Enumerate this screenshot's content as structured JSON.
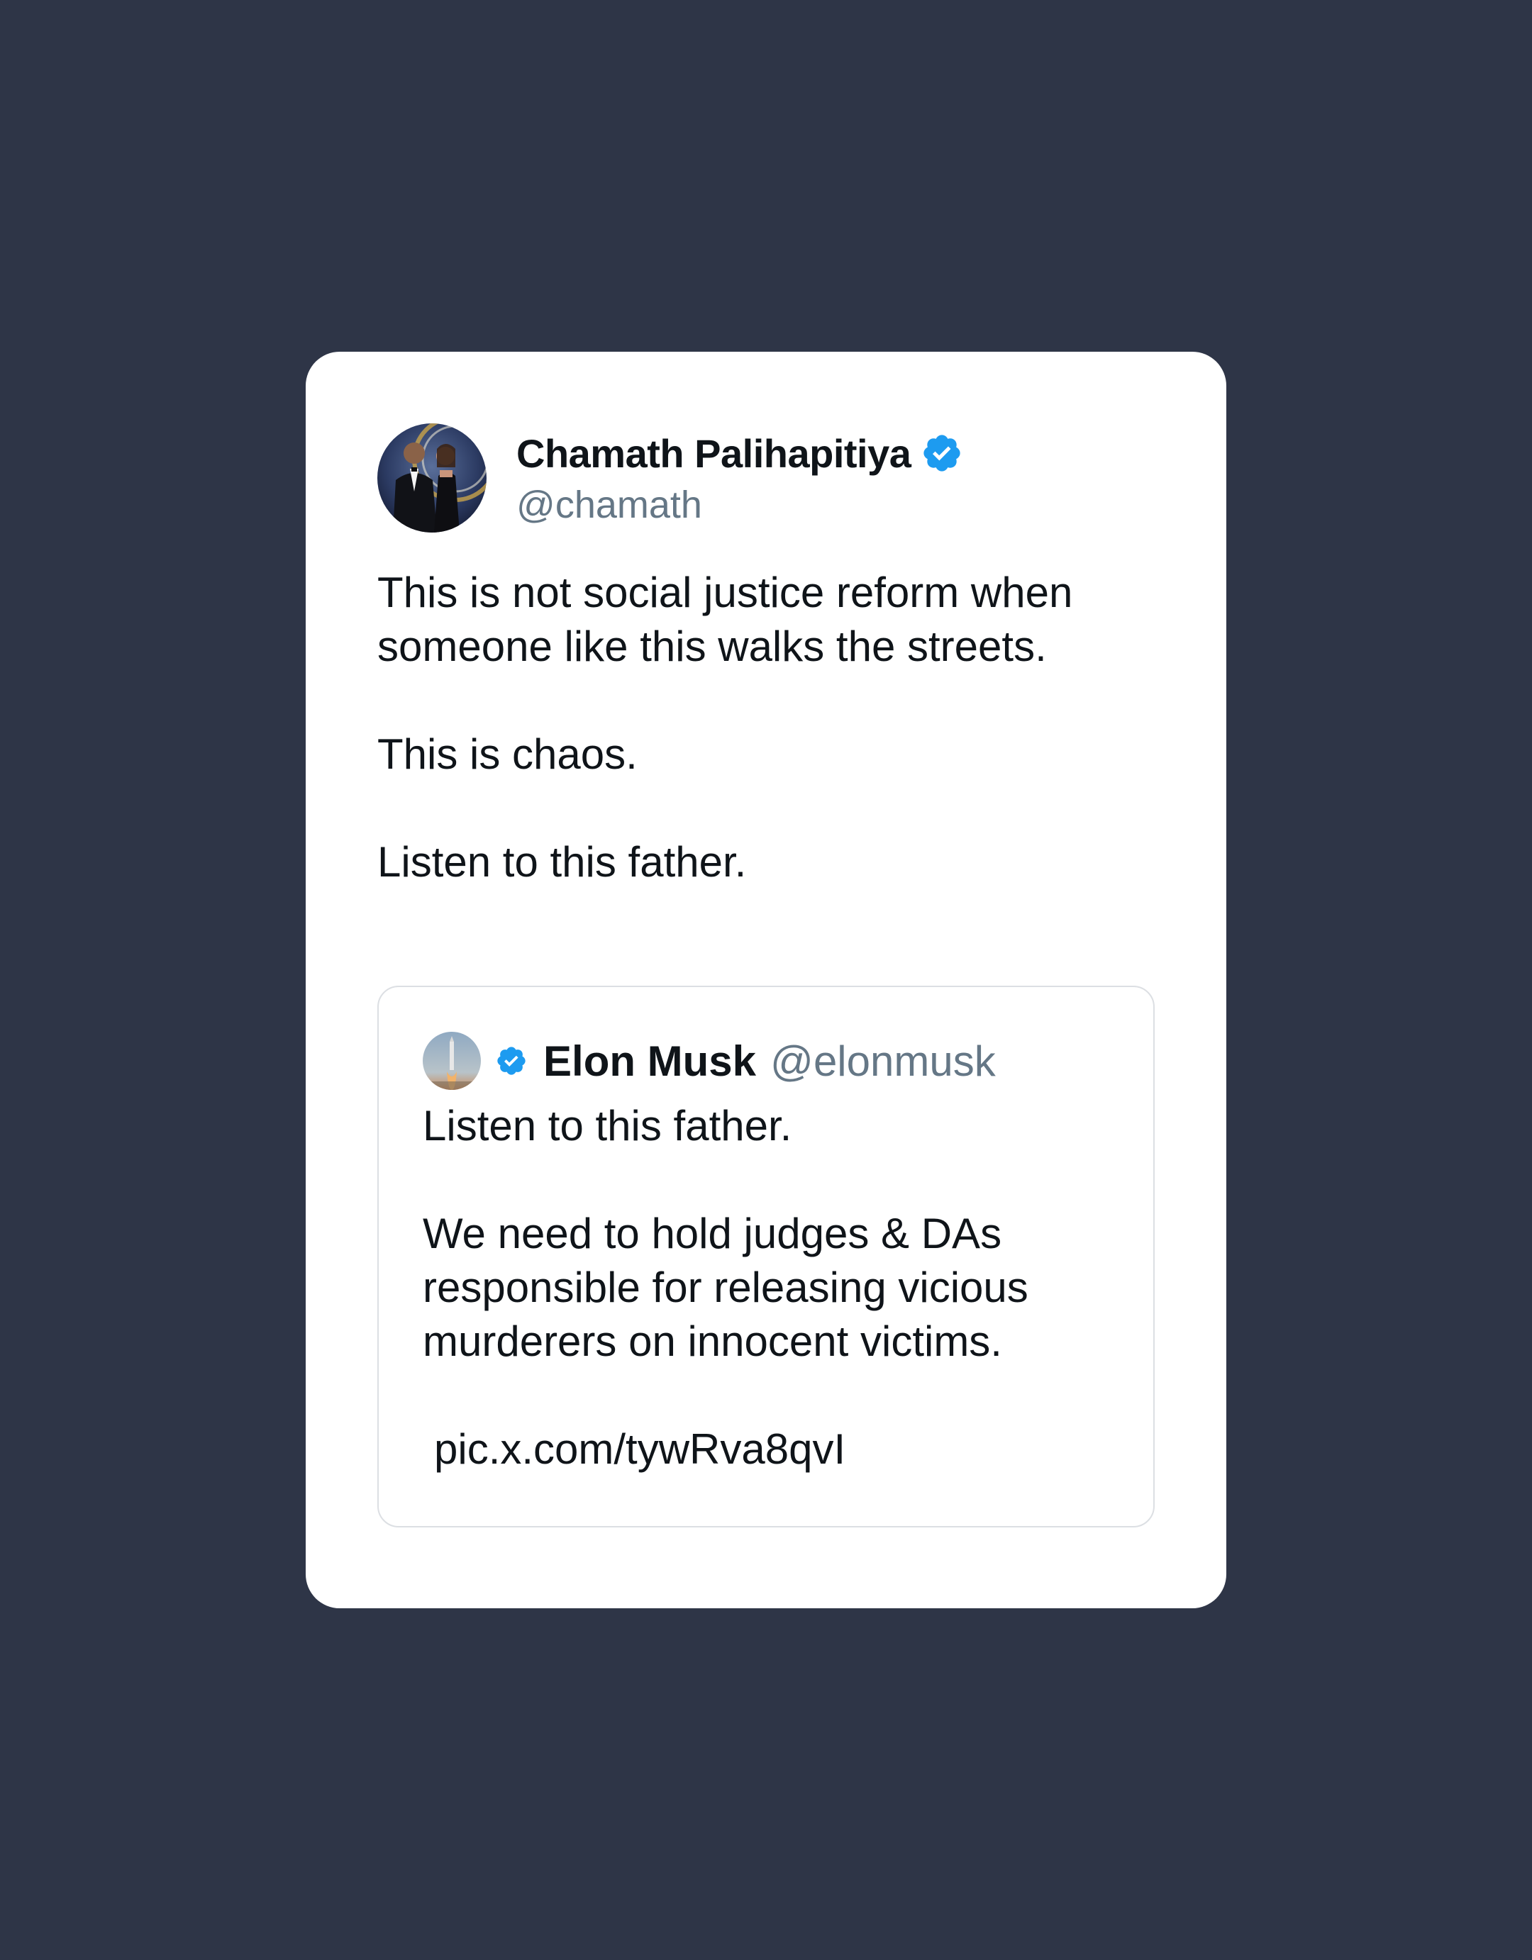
{
  "colors": {
    "background": "#2e3547",
    "card": "#ffffff",
    "verified": "#1d9bf0",
    "handle": "#657786",
    "text": "#0f1419"
  },
  "tweet": {
    "author_name": "Chamath Palihapitiya",
    "author_handle": "@chamath",
    "verified_icon": "verified-badge-icon",
    "body": [
      "This is not social justice reform when someone like this walks the streets.",
      "This is chaos.",
      "Listen to this father."
    ]
  },
  "quoted_tweet": {
    "author_name": "Elon Musk",
    "author_handle": "@elonmusk",
    "verified_icon": "verified-badge-icon",
    "body": [
      "Listen to this father.",
      "We need to hold judges & DAs responsible for releasing vicious murderers on innocent victims.",
      "pic.x.com/tywRva8qvI"
    ]
  }
}
